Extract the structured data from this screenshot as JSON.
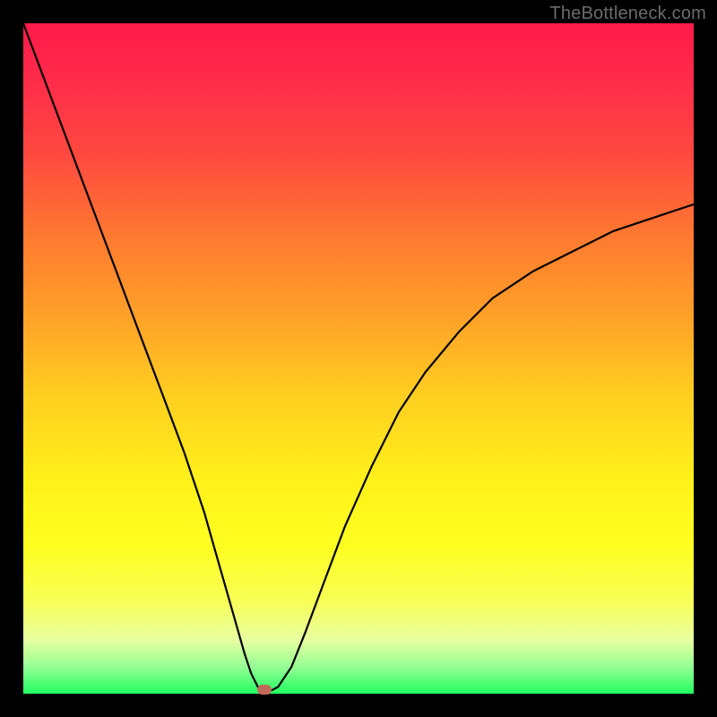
{
  "watermark": {
    "text": "TheBottleneck.com"
  },
  "chart_data": {
    "type": "line",
    "title": "",
    "xlabel": "",
    "ylabel": "",
    "xlim": [
      0,
      100
    ],
    "ylim": [
      0,
      100
    ],
    "grid": false,
    "legend": false,
    "series": [
      {
        "name": "curve",
        "x": [
          0,
          3,
          6,
          9,
          12,
          15,
          18,
          21,
          24,
          27,
          29,
          31,
          33,
          34,
          35,
          36,
          37,
          38,
          40,
          42,
          45,
          48,
          52,
          56,
          60,
          65,
          70,
          76,
          82,
          88,
          94,
          100
        ],
        "y": [
          100,
          92,
          84,
          76,
          68,
          60,
          52,
          44,
          36,
          27,
          20,
          13,
          6,
          3,
          1,
          0.5,
          0.5,
          1,
          4,
          9,
          17,
          25,
          34,
          42,
          48,
          54,
          59,
          63,
          66,
          69,
          71,
          73
        ]
      }
    ],
    "marker": {
      "x": 36,
      "y": 0.5,
      "color": "#c26a5a"
    },
    "gradient_stops": [
      {
        "pos": 0,
        "color": "#ff1a4a"
      },
      {
        "pos": 50,
        "color": "#ffd020"
      },
      {
        "pos": 78,
        "color": "#ffff20"
      },
      {
        "pos": 100,
        "color": "#20ff60"
      }
    ]
  }
}
